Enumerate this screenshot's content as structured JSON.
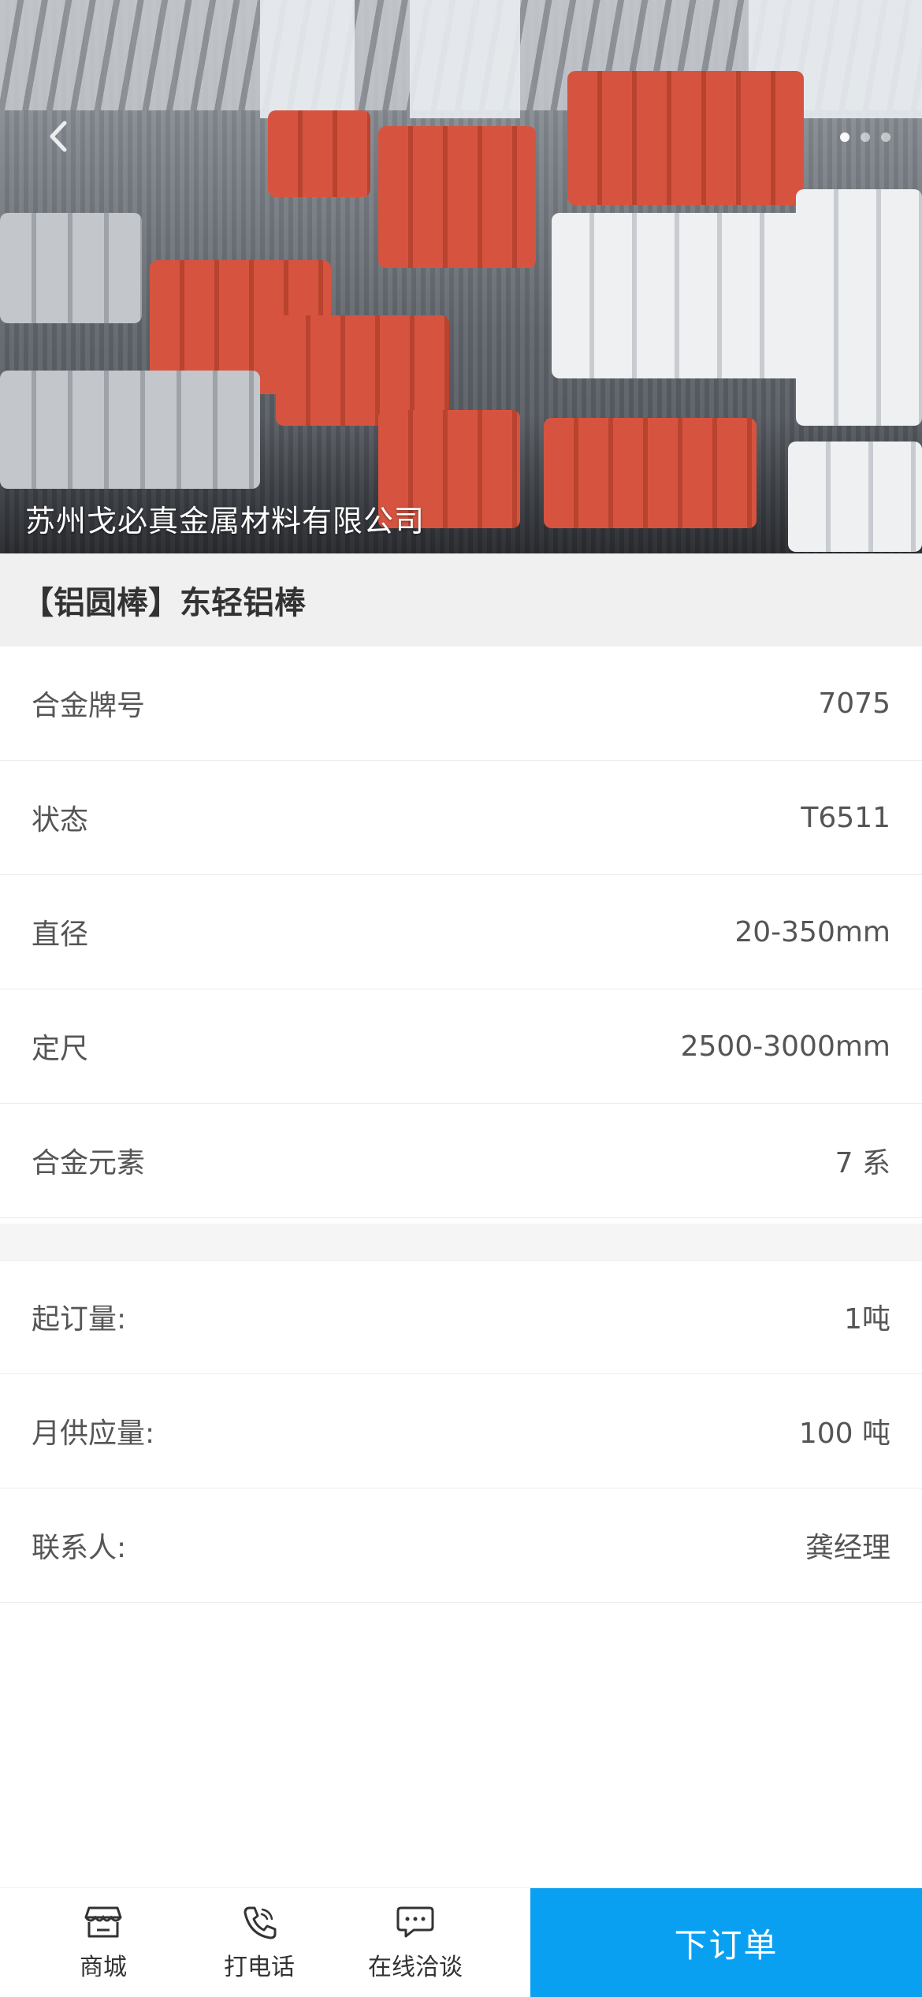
{
  "header": {
    "company_name": "苏州戈必真金属材料有限公司",
    "carousel_pages": 3,
    "carousel_active": 1
  },
  "product": {
    "title": "【铝圆棒】东轻铝棒"
  },
  "specs": [
    {
      "label": "合金牌号",
      "value": "7075"
    },
    {
      "label": "状态",
      "value": "T6511"
    },
    {
      "label": "直径",
      "value": "20-350mm"
    },
    {
      "label": "定尺",
      "value": "2500-3000mm"
    },
    {
      "label": "合金元素",
      "value": "7 系"
    }
  ],
  "supply": [
    {
      "label": "起订量:",
      "value": "1吨"
    },
    {
      "label": "月供应量:",
      "value": "100 吨"
    },
    {
      "label": "联系人:",
      "value": "龚经理"
    }
  ],
  "bottom_bar": {
    "shop_label": "商城",
    "shop_icon": "store-icon",
    "call_label": "打电话",
    "call_icon": "phone-icon",
    "chat_label": "在线洽谈",
    "chat_icon": "chat-icon",
    "order_label": "下订单",
    "order_color": "#0aa0f2"
  }
}
